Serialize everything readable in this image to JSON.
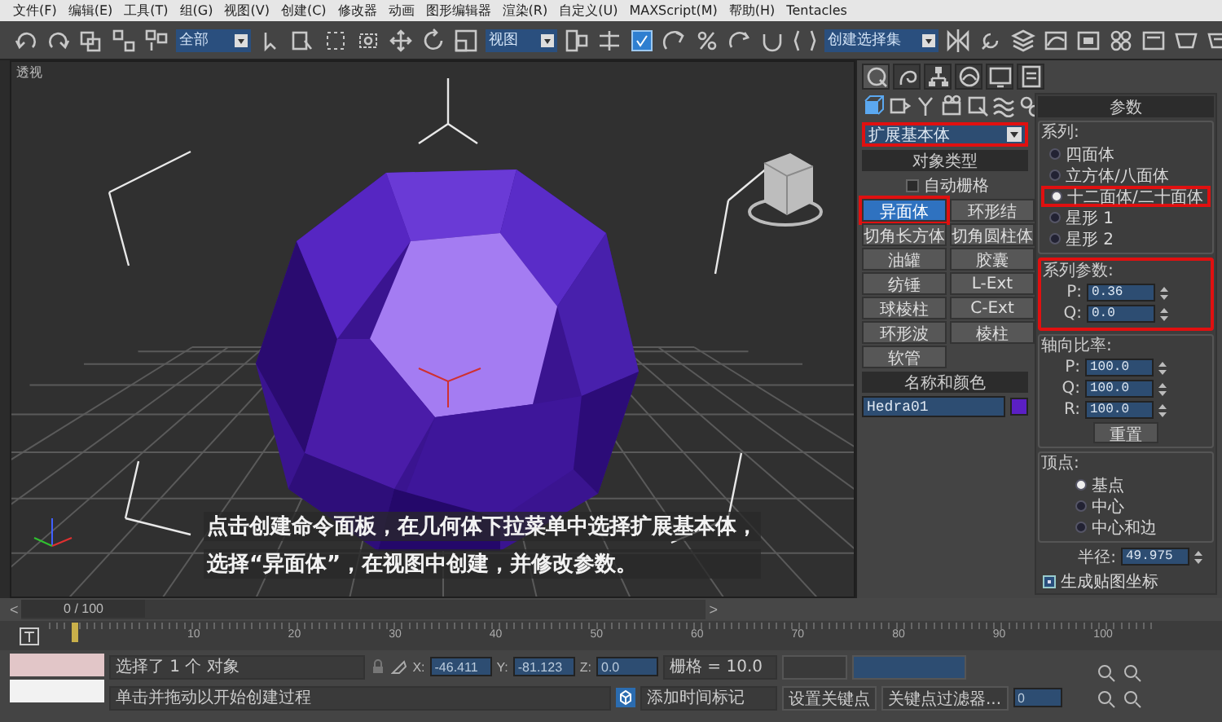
{
  "menu": [
    "文件(F)",
    "编辑(E)",
    "工具(T)",
    "组(G)",
    "视图(V)",
    "创建(C)",
    "修改器",
    "动画",
    "图形编辑器",
    "渲染(R)",
    "自定义(U)",
    "MAXScript(M)",
    "帮助(H)",
    "Tentacles"
  ],
  "toolbar": {
    "selection_filter": "全部",
    "reference_coordinate": "视图",
    "named_selection": "创建选择集"
  },
  "viewport": {
    "label": "透视",
    "caption": [
      "点击创建命令面板，在几何体下拉菜单中选择扩展基本体，",
      "选择“异面体”，在视图中创建，并修改参数。"
    ]
  },
  "command_panel": {
    "category": {
      "value": "扩展基本体",
      "highlighted": true
    },
    "object_type": {
      "title": "对象类型",
      "autogrid": {
        "label": "自动栅格",
        "checked": false
      },
      "buttons": [
        {
          "label": "异面体",
          "selected": true,
          "highlighted": true
        },
        {
          "label": "环形结",
          "selected": false,
          "highlighted": false
        },
        {
          "label": "切角长方体",
          "selected": false,
          "highlighted": false
        },
        {
          "label": "切角圆柱体",
          "selected": false,
          "highlighted": false
        },
        {
          "label": "油罐",
          "selected": false,
          "highlighted": false
        },
        {
          "label": "胶囊",
          "selected": false,
          "highlighted": false
        },
        {
          "label": "纺锤",
          "selected": false,
          "highlighted": false
        },
        {
          "label": "L-Ext",
          "selected": false,
          "highlighted": false
        },
        {
          "label": "球棱柱",
          "selected": false,
          "highlighted": false
        },
        {
          "label": "C-Ext",
          "selected": false,
          "highlighted": false
        },
        {
          "label": "环形波",
          "selected": false,
          "highlighted": false
        },
        {
          "label": "棱柱",
          "selected": false,
          "highlighted": false
        },
        {
          "label": "软管",
          "selected": false,
          "highlighted": false
        }
      ]
    },
    "name_and_color": {
      "title": "名称和颜色",
      "name": "Hedra01",
      "color": "#5b1fc4"
    },
    "parameters": {
      "title": "参数",
      "family": {
        "title": "系列:",
        "options": [
          {
            "label": "四面体",
            "selected": false,
            "highlighted": false
          },
          {
            "label": "立方体/八面体",
            "selected": false,
            "highlighted": false
          },
          {
            "label": "十二面体/二十面体",
            "selected": true,
            "highlighted": true
          },
          {
            "label": "星形 1",
            "selected": false,
            "highlighted": false
          },
          {
            "label": "星形 2",
            "selected": false,
            "highlighted": false
          }
        ]
      },
      "family_parameters": {
        "title": "系列参数:",
        "highlighted": true,
        "fields": [
          {
            "label": "P:",
            "value": "0.36"
          },
          {
            "label": "Q:",
            "value": "0.0"
          }
        ]
      },
      "axis_scale": {
        "title": "轴向比率:",
        "fields": [
          {
            "label": "P:",
            "value": "100.0"
          },
          {
            "label": "Q:",
            "value": "100.0"
          },
          {
            "label": "R:",
            "value": "100.0"
          }
        ],
        "reset": "重置"
      },
      "vertices": {
        "title": "顶点:",
        "options": [
          {
            "label": "基点",
            "selected": true
          },
          {
            "label": "中心",
            "selected": false
          },
          {
            "label": "中心和边",
            "selected": false
          }
        ]
      },
      "radius": {
        "label": "半径:",
        "value": "49.975"
      },
      "mapping": {
        "label": "生成贴图坐标",
        "checked": true
      }
    }
  },
  "timeline": {
    "previous": "<",
    "frame": "0 / 100",
    "next": ">",
    "ticks": [
      "10",
      "20",
      "30",
      "40",
      "50",
      "60",
      "70",
      "80",
      "90",
      "100"
    ]
  },
  "status_bar": {
    "selection": "选择了 1 个 对象",
    "prompt": "单击并拖动以开始创建过程",
    "coordinates": [
      {
        "label": "X:",
        "value": "-46.411"
      },
      {
        "label": "Y:",
        "value": "-81.123"
      },
      {
        "label": "Z:",
        "value": "0.0"
      }
    ],
    "grid": "栅格 = 10.0",
    "add_time_tag": "添加时间标记",
    "set_key": "设置关键点",
    "key_filters": "关键点过滤器...",
    "current_frame": "0"
  }
}
